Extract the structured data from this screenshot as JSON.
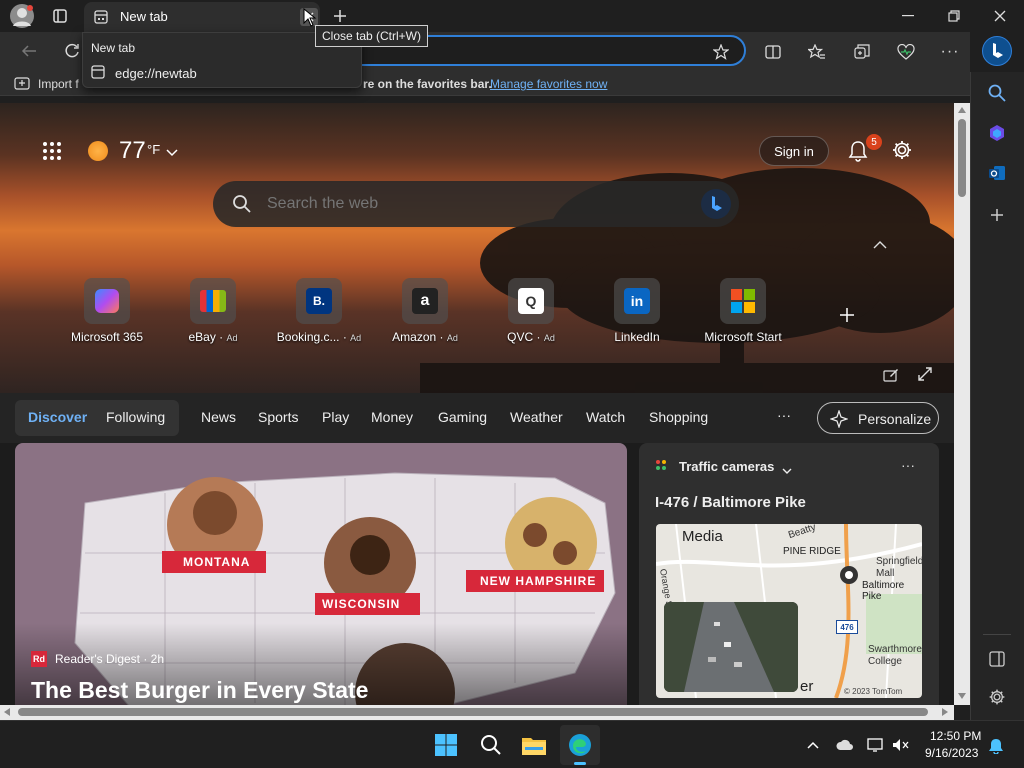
{
  "tab": {
    "title": "New tab"
  },
  "tooltip": "Close tab (Ctrl+W)",
  "hovercard": {
    "title": "New tab",
    "url": "edge://newtab"
  },
  "favbar": {
    "import_text": "Import f",
    "middle_text": "re on the favorites bar.",
    "manage_link": "Manage favorites now"
  },
  "weather": {
    "temp": "77",
    "unit": "°F"
  },
  "search": {
    "placeholder": "Search the web"
  },
  "header": {
    "sign_in": "Sign in",
    "notif_count": "5"
  },
  "tiles": [
    {
      "label": "Microsoft 365",
      "ad": "",
      "icon": "microsoft365-icon"
    },
    {
      "label": "eBay",
      "ad": "Ad",
      "icon": "ebay-icon"
    },
    {
      "label": "Booking.c...",
      "ad": "Ad",
      "icon": "booking-icon",
      "glyph": "B."
    },
    {
      "label": "Amazon",
      "ad": "Ad",
      "icon": "amazon-icon",
      "glyph": "a"
    },
    {
      "label": "QVC",
      "ad": "Ad",
      "icon": "qvc-icon",
      "glyph": "Q"
    },
    {
      "label": "LinkedIn",
      "ad": "",
      "icon": "linkedin-icon",
      "glyph": "in"
    },
    {
      "label": "Microsoft Start",
      "ad": "",
      "icon": "microsoft-start-icon"
    }
  ],
  "nav": {
    "tabs": [
      "Discover",
      "Following"
    ],
    "items": [
      "News",
      "Sports",
      "Play",
      "Money",
      "Gaming",
      "Weather",
      "Watch",
      "Shopping"
    ],
    "more": "···",
    "personalize": "Personalize"
  },
  "main_card": {
    "source": "Reader's Digest · 2h",
    "source_logo": "Rd",
    "headline": "The Best Burger in Every State",
    "banners": [
      "MONTANA",
      "WISCONSIN",
      "NEW HAMPSHIRE"
    ]
  },
  "traffic": {
    "title": "Traffic cameras",
    "location": "I-476 / Baltimore Pike",
    "map_labels": [
      "Media",
      "PINE RIDGE",
      "Beatty",
      "Orange St",
      "Springfield Mall",
      "Baltimore Pike",
      "476",
      "Swarthmore College",
      "er",
      "© 2023 TomTom"
    ]
  },
  "taskbar": {
    "time": "12:50 PM",
    "date": "9/16/2023"
  },
  "colors": {
    "accent": "#2f7fd8",
    "link": "#6fb1f5",
    "badge": "#d9421c",
    "banner_red": "#d7283a"
  }
}
